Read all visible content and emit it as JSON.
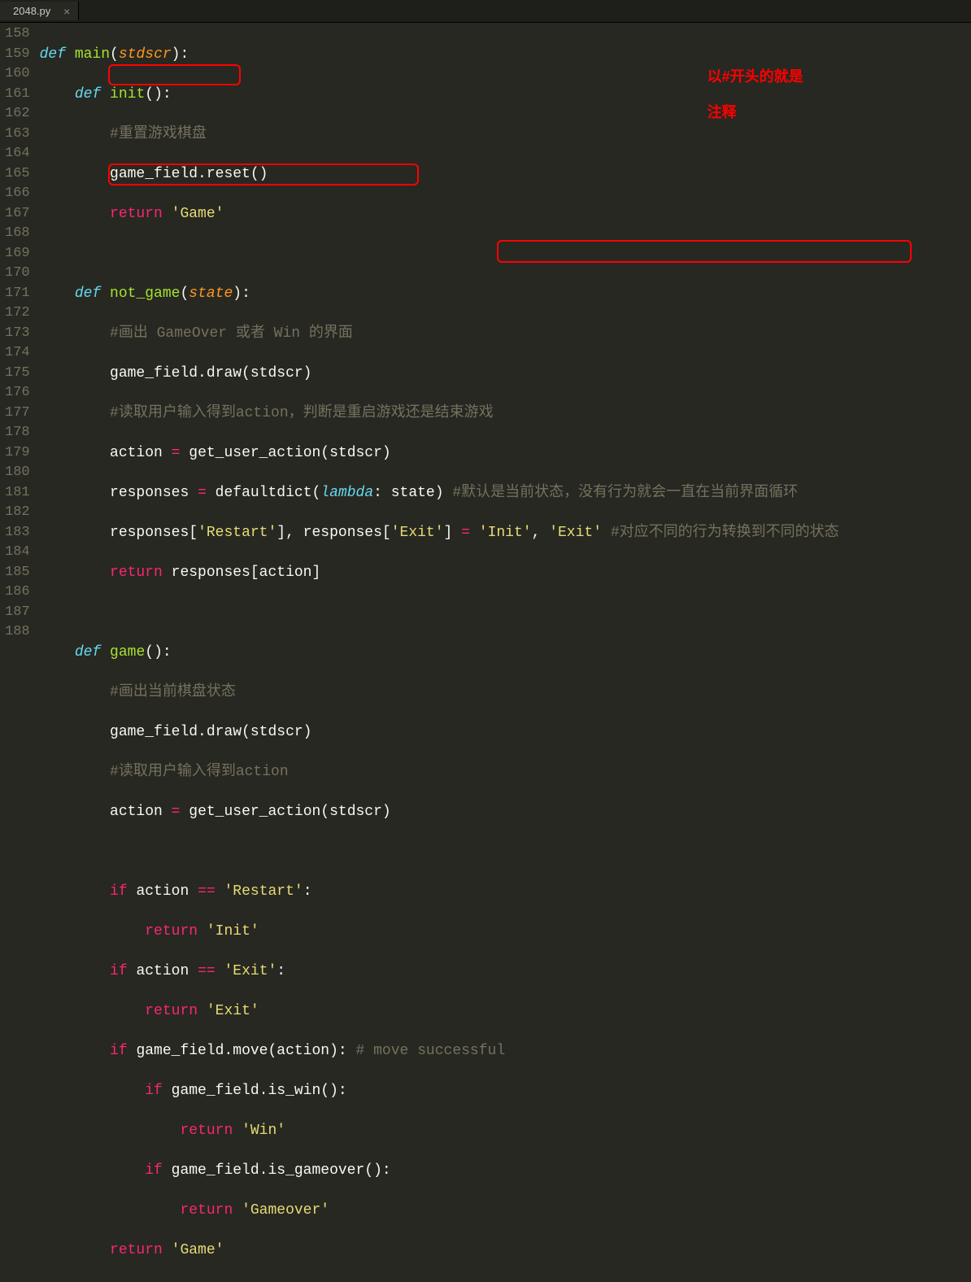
{
  "tab": {
    "filename": "2048.py",
    "close": "×"
  },
  "line_numbers": [
    "158",
    "159",
    "160",
    "161",
    "162",
    "163",
    "164",
    "165",
    "166",
    "167",
    "168",
    "169",
    "170",
    "171",
    "172",
    "173",
    "174",
    "175",
    "176",
    "177",
    "178",
    "179",
    "180",
    "181",
    "182",
    "183",
    "184",
    "185",
    "186",
    "187",
    "188"
  ],
  "annotation": {
    "line1": "以#开头的就是",
    "line2": "注释"
  },
  "code": {
    "l158": {
      "def": "def",
      "name": "main",
      "p": "stdscr"
    },
    "l159": {
      "def": "def",
      "name": "init"
    },
    "l160": {
      "comment": "#重置游戏棋盘"
    },
    "l161": {
      "text": "game_field.reset()"
    },
    "l162": {
      "ret": "return",
      "str": "'Game'"
    },
    "l164": {
      "def": "def",
      "name": "not_game",
      "p": "state"
    },
    "l165": {
      "comment": "#画出 GameOver 或者 Win 的界面"
    },
    "l166": {
      "text": "game_field.draw(stdscr)"
    },
    "l167": {
      "comment": "#读取用户输入得到action，判断是重启游戏还是结束游戏"
    },
    "l168": {
      "a": "action ",
      "op": "=",
      "b": " get_user_action(stdscr)"
    },
    "l169": {
      "a": "responses ",
      "op": "=",
      "b": " defaultdict(",
      "lam": "lambda",
      "c": ": state) ",
      "comment": "#默认是当前状态，没有行为就会一直在当前界面循环"
    },
    "l170": {
      "a": "responses[",
      "s1": "'Restart'",
      "b": "], responses[",
      "s2": "'Exit'",
      "c": "] ",
      "op": "=",
      "d": " ",
      "s3": "'Init'",
      "e": ", ",
      "s4": "'Exit'",
      "f": " ",
      "comment": "#对应不同的行为转换到不同的状态"
    },
    "l171": {
      "ret": "return",
      "text": " responses[action]"
    },
    "l173": {
      "def": "def",
      "name": "game"
    },
    "l174": {
      "comment": "#画出当前棋盘状态"
    },
    "l175": {
      "text": "game_field.draw(stdscr)"
    },
    "l176": {
      "comment": "#读取用户输入得到action"
    },
    "l177": {
      "a": "action ",
      "op": "=",
      "b": " get_user_action(stdscr)"
    },
    "l179": {
      "if": "if",
      "a": " action ",
      "op": "==",
      "b": " ",
      "str": "'Restart'",
      "c": ":"
    },
    "l180": {
      "ret": "return",
      "str": "'Init'"
    },
    "l181": {
      "if": "if",
      "a": " action ",
      "op": "==",
      "b": " ",
      "str": "'Exit'",
      "c": ":"
    },
    "l182": {
      "ret": "return",
      "str": "'Exit'"
    },
    "l183": {
      "if": "if",
      "a": " game_field.move(action): ",
      "comment": "# move successful"
    },
    "l184": {
      "if": "if",
      "a": " game_field.is_win():"
    },
    "l185": {
      "ret": "return",
      "str": "'Win'"
    },
    "l186": {
      "if": "if",
      "a": " game_field.is_gameover():"
    },
    "l187": {
      "ret": "return",
      "str": "'Gameover'"
    },
    "l188": {
      "ret": "return",
      "str": "'Game'"
    }
  }
}
